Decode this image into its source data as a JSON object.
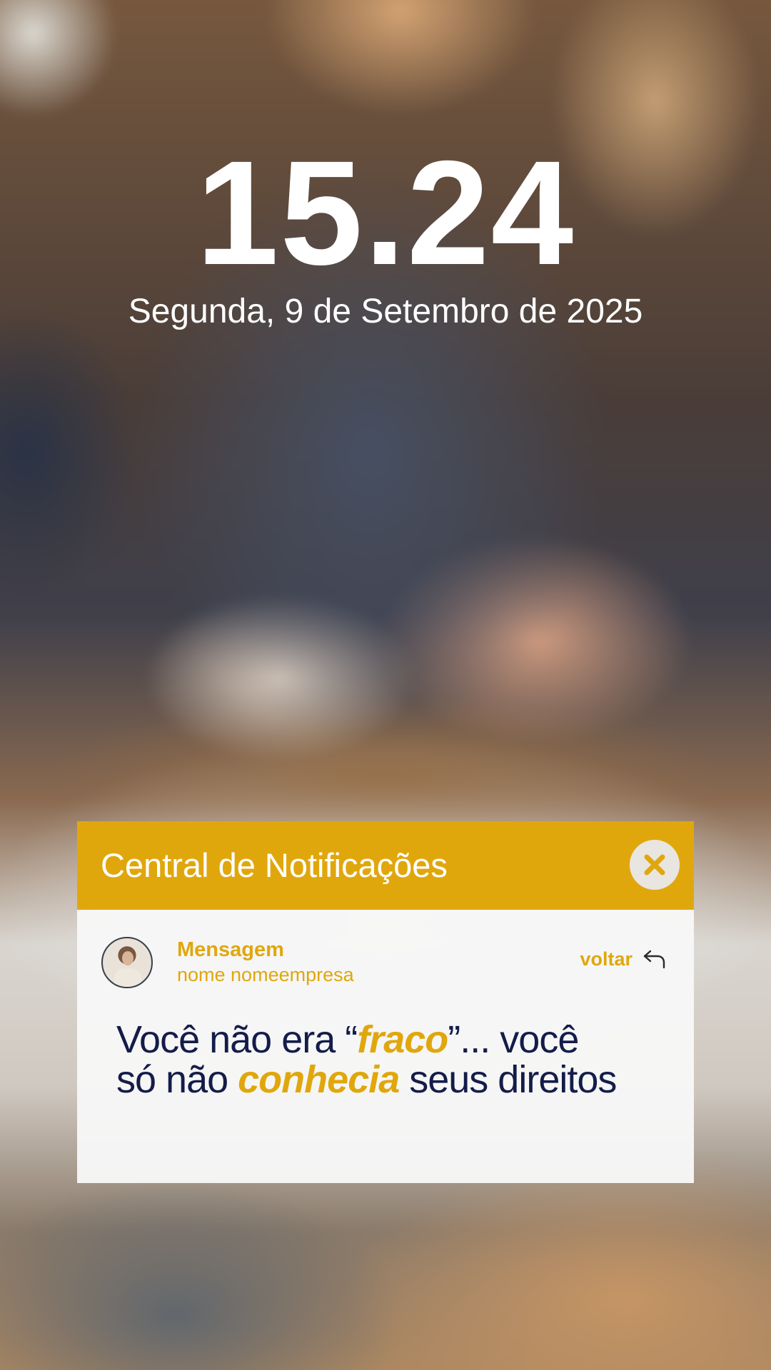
{
  "lockscreen": {
    "time": "15.24",
    "date": "Segunda, 9 de Setembro de 2025"
  },
  "notification_center": {
    "title": "Central de Notificações",
    "close_icon": "close-x-icon",
    "accent_color": "#e0a70d",
    "message": {
      "sender_label": "Mensagem",
      "company": "nome nomeempresa",
      "back_label": "voltar",
      "back_icon": "reply-arrow-icon",
      "text_parts": {
        "p1": "Você não era “",
        "highlight1": "fraco",
        "p2": "”... você",
        "p3": "só não ",
        "highlight2": "conhecia",
        "p4": " seus direitos"
      },
      "text_color": "#141c4a"
    }
  }
}
